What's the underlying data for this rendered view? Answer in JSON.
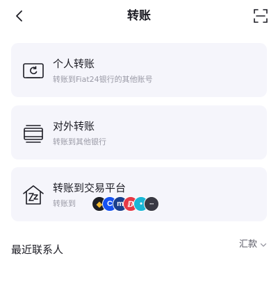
{
  "header": {
    "title": "转账"
  },
  "options": [
    {
      "title": "个人转账",
      "subtitle": "转账到Fiat24银行的其他账号",
      "icon": "personal-transfer-icon"
    },
    {
      "title": "对外转账",
      "subtitle": "转账到其他银行",
      "icon": "external-transfer-icon"
    },
    {
      "title": "转账到交易平台",
      "subtitle": "转账到",
      "icon": "exchange-platform-icon",
      "logos": [
        {
          "name": "binance-logo",
          "bg": "#1e2026",
          "fg": "#f3ba2f",
          "glyph": "◆"
        },
        {
          "name": "coinbase-logo",
          "bg": "#1652f0",
          "fg": "#ffffff",
          "glyph": "C"
        },
        {
          "name": "crypto-com-logo",
          "bg": "#1a3f8c",
          "fg": "#ffffff",
          "glyph": "m"
        },
        {
          "name": "platform-logo-red",
          "bg": "#e63946",
          "fg": "#ffffff",
          "glyph": "ⅅ"
        },
        {
          "name": "platform-logo-cyan",
          "bg": "#1ab7d6",
          "fg": "#ffffff",
          "glyph": "•"
        },
        {
          "name": "more-platforms-icon",
          "bg": "#3a3a44",
          "fg": "#ffffff",
          "glyph": "···"
        }
      ]
    }
  ],
  "recent": {
    "label": "最近联系人",
    "filter_label": "汇款"
  },
  "colors": {
    "card_bg": "#f5f5fb",
    "primary_text": "#1c1c24",
    "secondary_text": "#9a9aa6"
  }
}
